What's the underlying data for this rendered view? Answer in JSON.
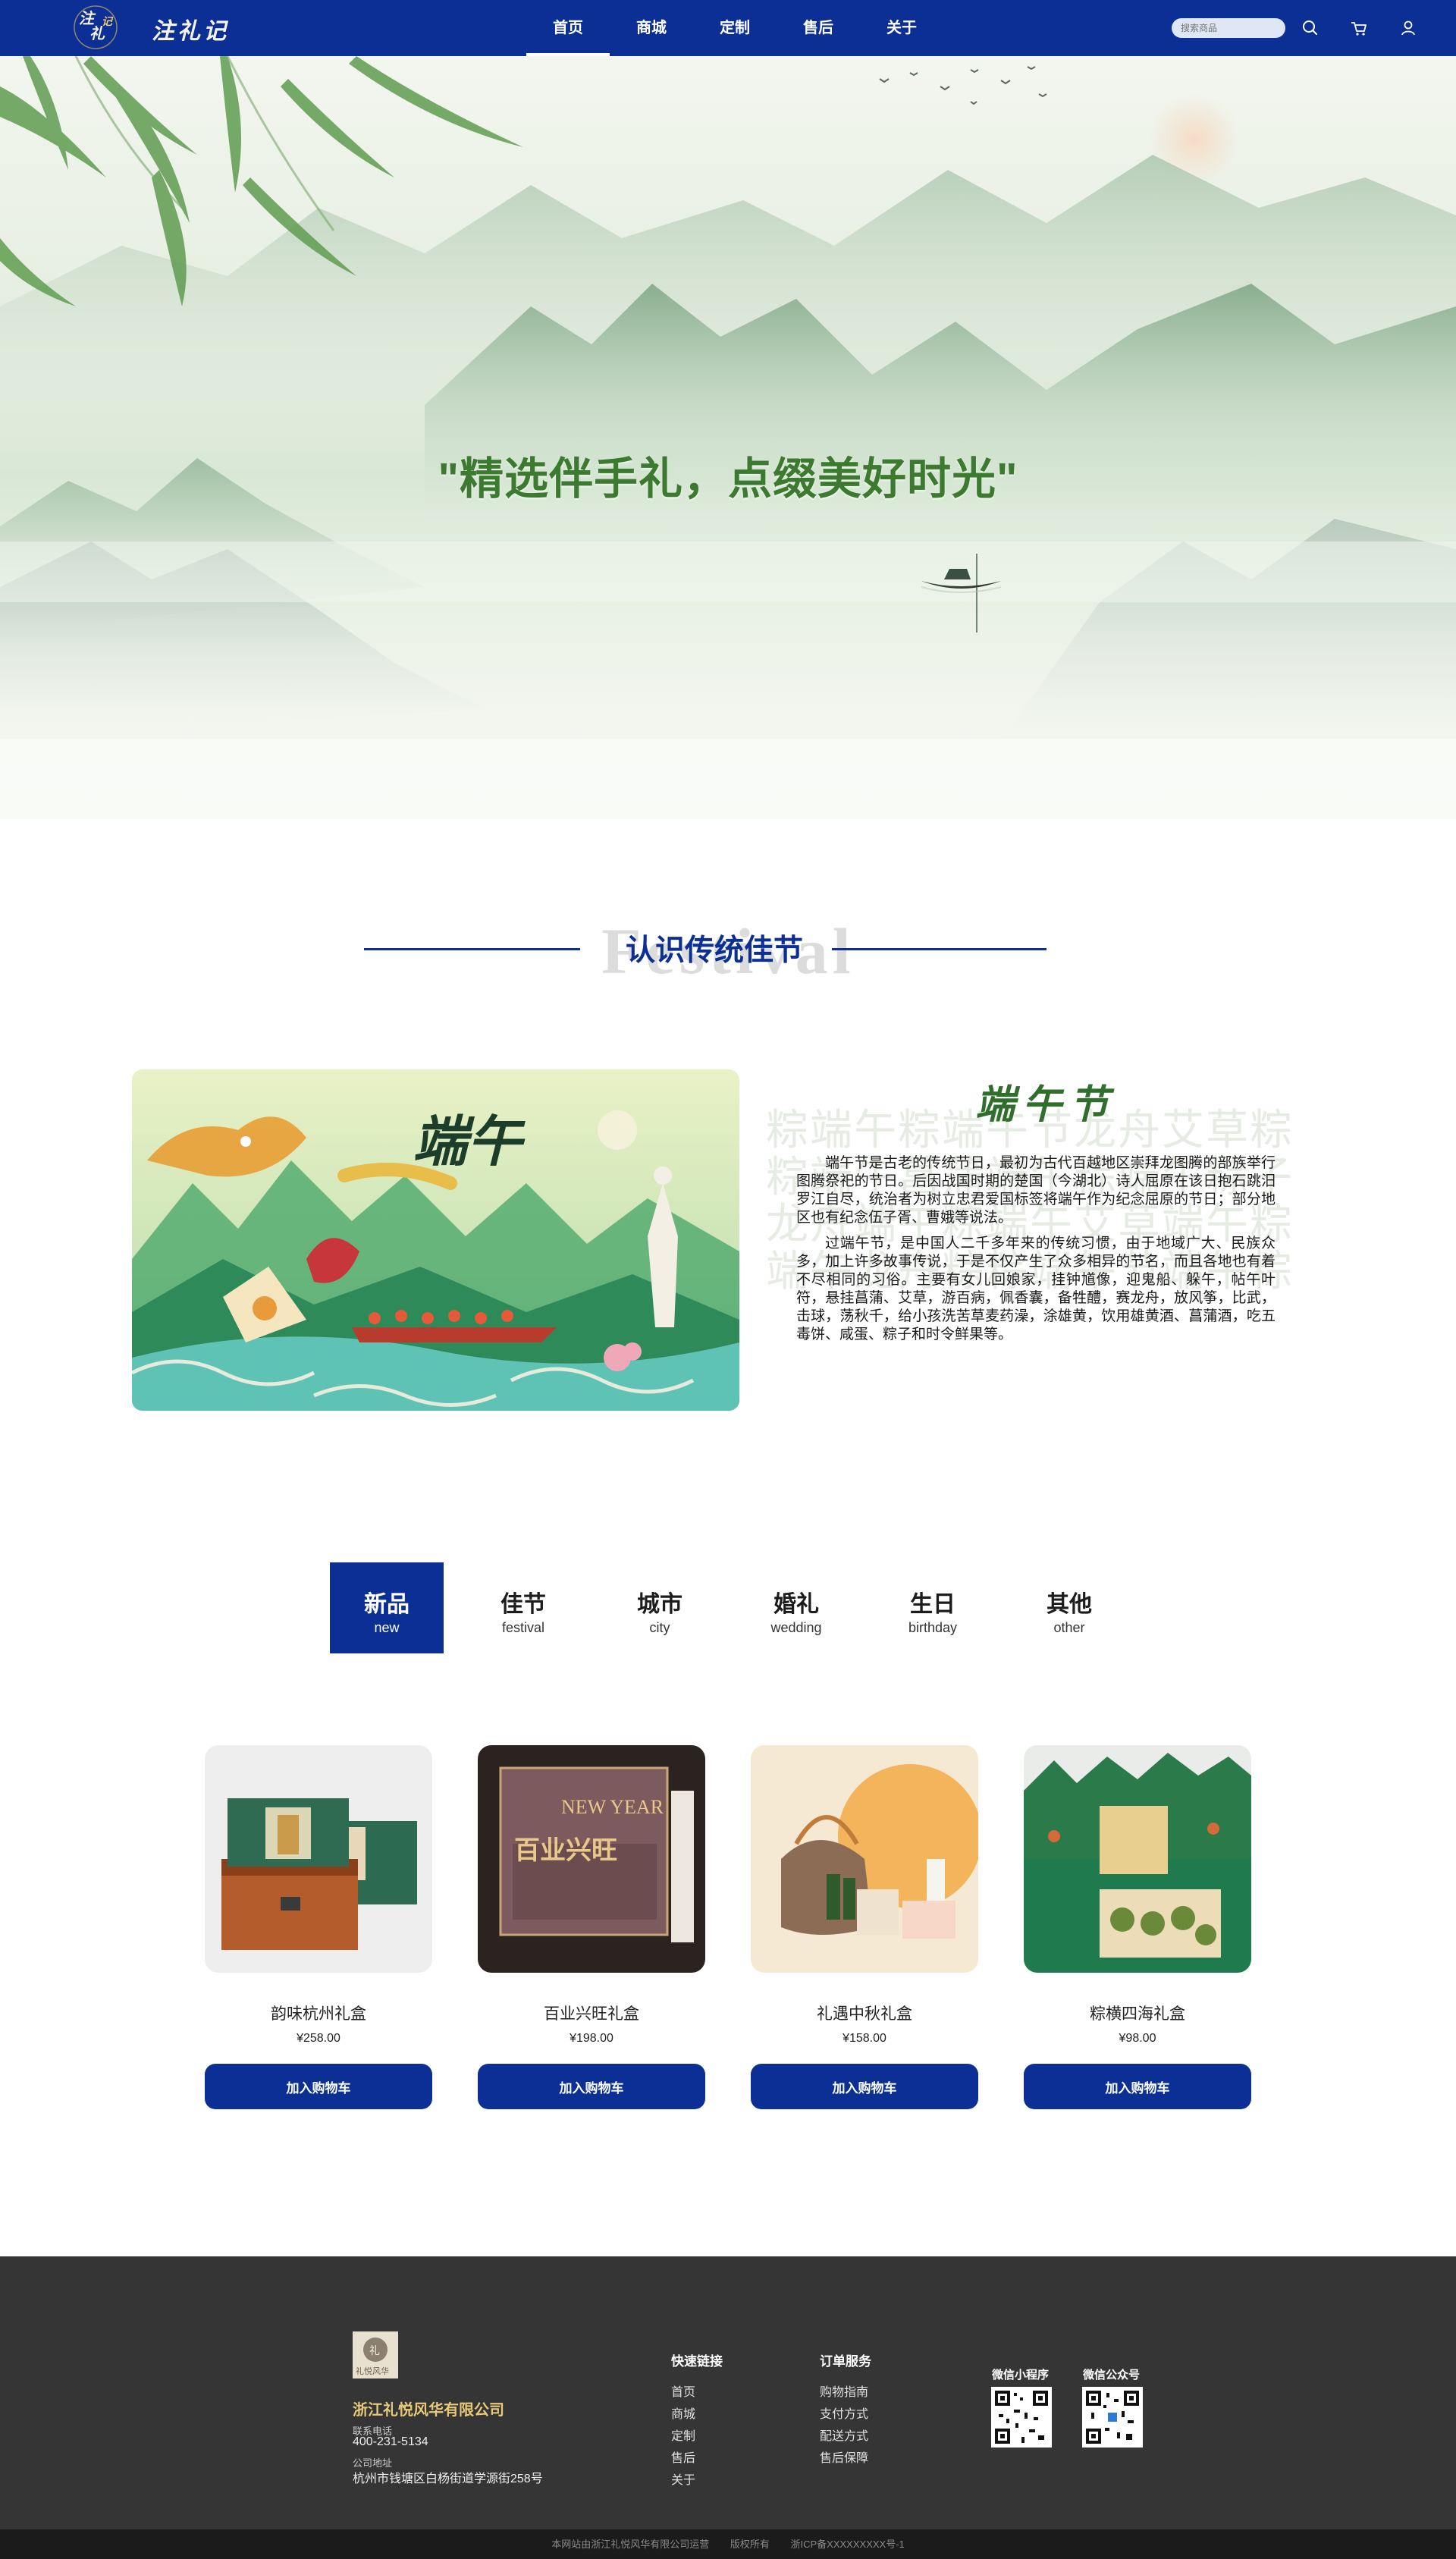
{
  "nav": {
    "logo_text": "注礼记",
    "links": [
      {
        "label": "首页",
        "active": true
      },
      {
        "label": "商城",
        "active": false
      },
      {
        "label": "定制",
        "active": false
      },
      {
        "label": "售后",
        "active": false
      },
      {
        "label": "关于",
        "active": false
      }
    ],
    "search_placeholder": "搜索商品",
    "icons": [
      "search-icon",
      "cart-icon",
      "user-icon"
    ]
  },
  "hero": {
    "slogan": "\"精选伴手礼，点缀美好时光\""
  },
  "section": {
    "title_cn": "认识传统佳节",
    "title_bg_word": "Festival"
  },
  "festival": {
    "name": "端午节",
    "image_label": "端午",
    "paragraphs": [
      "端午节是古老的传统节日，最初为古代百越地区崇拜龙图腾的部族举行图腾祭祀的节日。后因战国时期的楚国（今湖北）诗人屈原在该日抱石跳汨罗江自尽，统治者为树立忠君爱国标签将端午作为纪念屈原的节日；部分地区也有纪念伍子胥、曹娥等说法。",
      "过端午节，是中国人二千多年来的传统习惯，由于地域广大、民族众多，加上许多故事传说，于是不仅产生了众多相异的节名，而且各地也有着不尽相同的习俗。主要有女儿回娘家，挂钟馗像，迎鬼船、躲午，帖午叶符，悬挂菖蒲、艾草，游百病，佩香囊，备牲醴，赛龙舟，放风筝，比武，击球，荡秋千，给小孩洗苦草麦药澡，涂雄黄，饮用雄黄酒、菖蒲酒，吃五毒饼、咸蛋、粽子和时令鲜果等。"
    ],
    "bg_chars": "粽端午粽端午节龙舟艾草粽粽端午菖蒲端午粽端午粽子龙舟端午粽端午艾草端午粽端午龙舟粽粽端午节端午粽"
  },
  "tabs": [
    {
      "cn": "新品",
      "en": "new",
      "active": true
    },
    {
      "cn": "佳节",
      "en": "festival",
      "active": false
    },
    {
      "cn": "城市",
      "en": "city",
      "active": false
    },
    {
      "cn": "婚礼",
      "en": "wedding",
      "active": false
    },
    {
      "cn": "生日",
      "en": "birthday",
      "active": false
    },
    {
      "cn": "其他",
      "en": "other",
      "active": false
    }
  ],
  "products": [
    {
      "name": "韵味杭州礼盒",
      "price": "¥258.00",
      "button": "加入购物车"
    },
    {
      "name": "百业兴旺礼盒",
      "price": "¥198.00",
      "button": "加入购物车",
      "box_text": "NEW YEAR",
      "box_cn": "百业兴旺"
    },
    {
      "name": "礼遇中秋礼盒",
      "price": "¥158.00",
      "button": "加入购物车"
    },
    {
      "name": "粽横四海礼盒",
      "price": "¥98.00",
      "button": "加入购物车"
    }
  ],
  "footer": {
    "company": "浙江礼悦风华有限公司",
    "logo_text": "礼悦风华",
    "phone_label": "联系电话",
    "phone": "400-231-5134",
    "address_label": "公司地址",
    "address": "杭州市钱塘区白杨街道学源街258号",
    "quick_links_title": "快速链接",
    "quick_links": [
      "首页",
      "商城",
      "定制",
      "售后",
      "关于"
    ],
    "order_title": "订单服务",
    "order_links": [
      "购物指南",
      "支付方式",
      "配送方式",
      "售后保障"
    ],
    "mini_program_label": "微信小程序",
    "official_account_label": "微信公众号"
  },
  "bottom": {
    "operated": "本网站由浙江礼悦风华有限公司运营",
    "rights": "版权所有",
    "icp": "浙ICP备XXXXXXXXX号-1"
  },
  "colors": {
    "primary": "#0b2f95",
    "footer_bg": "#353535",
    "hero_green": "#3c7a2f",
    "festival_title": "#2f6e2b",
    "company_gold": "#e8c97a"
  }
}
